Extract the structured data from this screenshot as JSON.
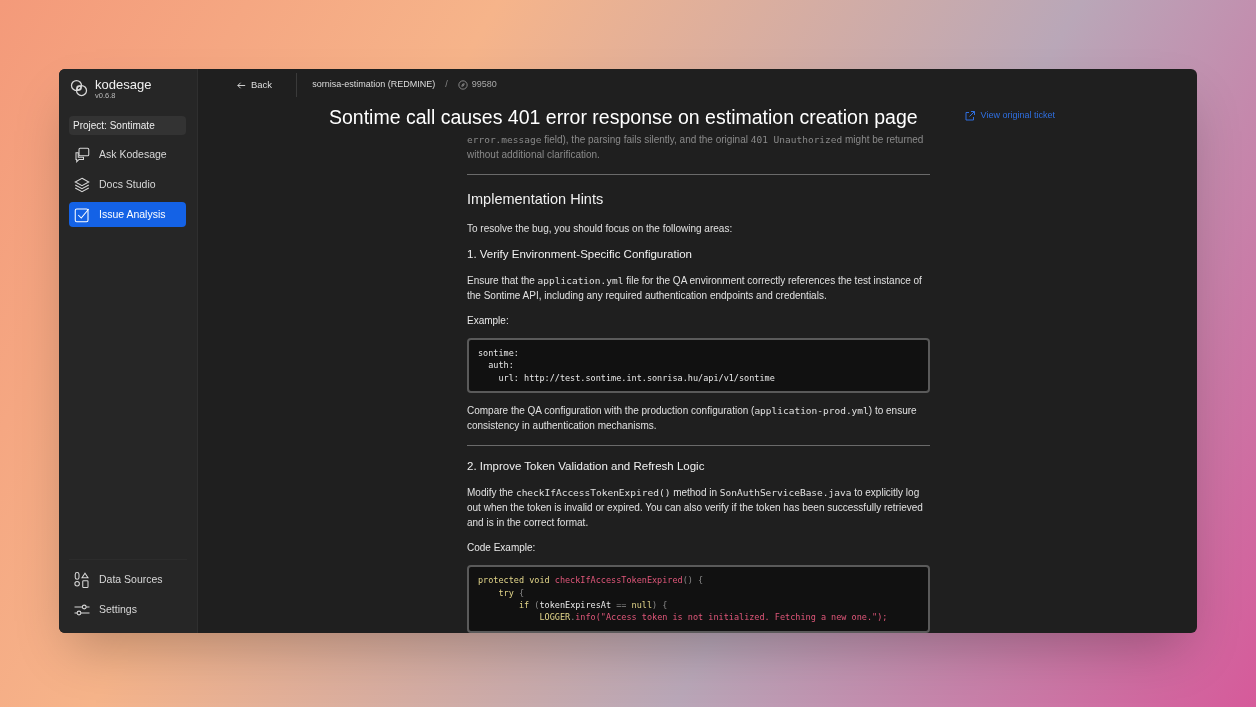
{
  "brand": {
    "name": "kodesage",
    "version": "v0.6.8"
  },
  "project": "Project: Sontimate",
  "nav": [
    {
      "kind": "chat",
      "label": "Ask Kodesage",
      "selected": false
    },
    {
      "kind": "layers",
      "label": "Docs Studio",
      "selected": false
    },
    {
      "kind": "check",
      "label": "Issue Analysis",
      "selected": true
    }
  ],
  "nav_bottom": [
    {
      "kind": "sources",
      "label": "Data Sources",
      "selected": false
    },
    {
      "kind": "sliders",
      "label": "Settings",
      "selected": false
    }
  ],
  "header": {
    "back": "Back",
    "source": "sornisa-estimation (REDMINE)",
    "separator": "/",
    "ticket": "99580"
  },
  "title": "Sontime call causes 401 error response on estimation creation page",
  "view_original": "View original ticket",
  "blocks": [
    {
      "kind": "paragraph",
      "faded": true,
      "segments": [
        {
          "kind": "code",
          "t": "error.message"
        },
        {
          "kind": "text",
          "t": " field), the parsing fails silently, and the original "
        },
        {
          "kind": "code",
          "t": "401 Unauthorized"
        },
        {
          "kind": "text",
          "t": " might be returned without additional clarification."
        }
      ]
    },
    {
      "kind": "divider"
    },
    {
      "kind": "heading",
      "text": "Implementation Hints"
    },
    {
      "kind": "paragraph",
      "faded": false,
      "segments": [
        {
          "kind": "text",
          "t": "To resolve the bug, you should focus on the following areas:"
        }
      ]
    },
    {
      "kind": "subheading",
      "text": "1. Verify Environment-Specific Configuration"
    },
    {
      "kind": "paragraph",
      "faded": false,
      "segments": [
        {
          "kind": "text",
          "t": "Ensure that the "
        },
        {
          "kind": "code",
          "t": "application.yml"
        },
        {
          "kind": "text",
          "t": " file for the QA environment correctly references the test instance of the Sontime API, including any required authentication endpoints and credentials."
        }
      ]
    },
    {
      "kind": "label",
      "text": "Example:"
    },
    {
      "kind": "code",
      "lines": [
        [
          {
            "kind": "plain",
            "t": "sontime:"
          }
        ],
        [
          {
            "kind": "plain",
            "t": "  auth:"
          }
        ],
        [
          {
            "kind": "plain",
            "t": "    url: http://test.sontime.int.sonrisa.hu/api/v1/sontime"
          }
        ]
      ]
    },
    {
      "kind": "paragraph",
      "faded": false,
      "segments": [
        {
          "kind": "text",
          "t": "Compare the QA configuration with the production configuration ("
        },
        {
          "kind": "code",
          "t": "application-prod.yml"
        },
        {
          "kind": "text",
          "t": ") to ensure consistency in authentication mechanisms."
        }
      ]
    },
    {
      "kind": "divider"
    },
    {
      "kind": "subheading",
      "text": "2. Improve Token Validation and Refresh Logic"
    },
    {
      "kind": "paragraph",
      "faded": false,
      "segments": [
        {
          "kind": "text",
          "t": "Modify the "
        },
        {
          "kind": "code",
          "t": "checkIfAccessTokenExpired()"
        },
        {
          "kind": "text",
          "t": " method in "
        },
        {
          "kind": "code",
          "t": "SonAuthServiceBase.java"
        },
        {
          "kind": "text",
          "t": " to explicitly log out when the token is invalid or expired. You can also verify if the token has been successfully retrieved and is in the correct format."
        }
      ]
    },
    {
      "kind": "label",
      "text": "Code Example:"
    },
    {
      "kind": "code",
      "lines": [
        [
          {
            "kind": "keyword",
            "t": "protected void "
          },
          {
            "kind": "function",
            "t": "checkIfAccessTokenExpired"
          },
          {
            "kind": "punct",
            "t": "() {"
          }
        ],
        [
          {
            "kind": "keyword",
            "t": "    try "
          },
          {
            "kind": "punct",
            "t": "{"
          }
        ],
        [
          {
            "kind": "keyword",
            "t": "        if "
          },
          {
            "kind": "punct",
            "t": "("
          },
          {
            "kind": "plain",
            "t": "tokenExpiresAt "
          },
          {
            "kind": "punct",
            "t": "== "
          },
          {
            "kind": "keyword",
            "t": "null"
          },
          {
            "kind": "punct",
            "t": ") {"
          }
        ],
        [
          {
            "kind": "keyword",
            "t": "            LOGGER"
          },
          {
            "kind": "punct",
            "t": "."
          },
          {
            "kind": "function",
            "t": "info(\"Access token is not initialized. Fetching a new one.\");"
          }
        ]
      ]
    }
  ]
}
